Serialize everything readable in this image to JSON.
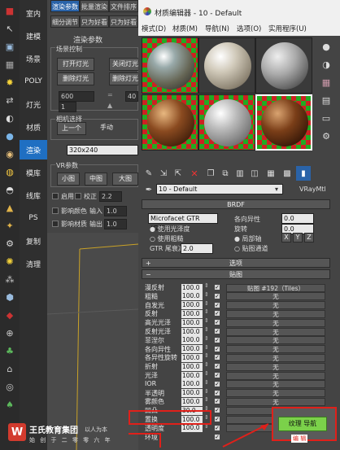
{
  "left_categories": [
    "室内",
    "建模",
    "场景",
    "POLY",
    "灯光",
    "材质",
    "渲染",
    "模库",
    "线库",
    "PS",
    "复制",
    "清理"
  ],
  "left_categories_active": 6,
  "render_panel": {
    "tabs": [
      "渲染参数",
      "批量渲染",
      "文件排序",
      "细分调节",
      "只为好看",
      "只为好看"
    ],
    "section_title": "渲染参数",
    "scene_control_label": "场景控制",
    "buttons_row1": [
      "打开灯光",
      "关闭灯光"
    ],
    "buttons_row2": [
      "删除灯光",
      "删除灯光"
    ],
    "spinner_600": "600",
    "spinner_40": "40",
    "spinner_1": "1",
    "camera_label": "相机选择",
    "camera_buttons": [
      "上一个",
      "手动"
    ],
    "resolution_value": "320x240",
    "vr_params_label": "VR参数",
    "size_buttons": [
      "小图",
      "中图",
      "大图"
    ],
    "enable_label": "启用",
    "correction_label": "校正",
    "correction_value": "2.2",
    "affect_color_label": "影响颜色",
    "input_label": "输入",
    "input_value": "1.0",
    "affect_material_label": "影响材质",
    "output_label": "输出",
    "output_value": "1.0"
  },
  "brand": {
    "name": "王氏教育集团",
    "slogan": "以人为本",
    "tagline": "始 创 于 二 零 零 六 年"
  },
  "material_editor": {
    "title": "材质编辑器 - 10 - Default",
    "menu": [
      "模式(D)",
      "材质(M)",
      "导航(N)",
      "选项(O)",
      "实用程序(U)"
    ],
    "material_name": "10 - Default",
    "material_type": "VRayMtl",
    "brdf_rollout": "BRDF",
    "brdf_type": "Microfacet GTR (GGX)",
    "anisotropy_label": "各向异性",
    "anisotropy_value": "0.0",
    "rotation_label": "旋转",
    "rotation_value": "0.0",
    "use_glossiness_label": "使用光泽度",
    "use_roughness_label": "使用粗糙",
    "local_axis_label": "局部轴",
    "axes": [
      "X",
      "Y",
      "Z"
    ],
    "map_channel_label": "贴图通道",
    "gtr_tail_label": "GTR 尾衰减",
    "gtr_tail_value": "2.0",
    "options_rollout": "选项",
    "maps_rollout": "贴图",
    "maps": [
      {
        "label": "漫反射",
        "value": "100.0",
        "checked": true,
        "map": "贴图 #192（Tiles）"
      },
      {
        "label": "粗糙",
        "value": "100.0",
        "checked": true,
        "map": "无"
      },
      {
        "label": "自发光",
        "value": "100.0",
        "checked": true,
        "map": "无"
      },
      {
        "label": "反射",
        "value": "100.0",
        "checked": true,
        "map": "无"
      },
      {
        "label": "高光光泽",
        "value": "100.0",
        "checked": true,
        "map": "无"
      },
      {
        "label": "反射光泽",
        "value": "100.0",
        "checked": true,
        "map": "无"
      },
      {
        "label": "菲涅尔",
        "value": "100.0",
        "checked": true,
        "map": "无"
      },
      {
        "label": "各向异性",
        "value": "100.0",
        "checked": true,
        "map": "无"
      },
      {
        "label": "各异性旋转",
        "value": "100.0",
        "checked": true,
        "map": "无"
      },
      {
        "label": "折射",
        "value": "100.0",
        "checked": true,
        "map": "无"
      },
      {
        "label": "光泽",
        "value": "100.0",
        "checked": true,
        "map": "无"
      },
      {
        "label": "IOR",
        "value": "100.0",
        "checked": true,
        "map": "无"
      },
      {
        "label": "半透明",
        "value": "100.0",
        "checked": true,
        "map": "无"
      },
      {
        "label": "雾颜色",
        "value": "100.0",
        "checked": true,
        "map": "无"
      },
      {
        "label": "凹凸",
        "value": "30.0",
        "checked": true,
        "map": "无"
      },
      {
        "label": "置换",
        "value": "100.0",
        "checked": true,
        "map": "无"
      },
      {
        "label": "透明度",
        "value": "100.0",
        "checked": true,
        "map": "无"
      },
      {
        "label": "环境",
        "value": "",
        "checked": true,
        "map": ""
      }
    ],
    "popup_text": "纹理 导航",
    "popup_sub": "编 辑"
  },
  "colors": {
    "accent": "#1f6fc2",
    "highlight_box": "#e0201a",
    "popup_green": "#7bd14a"
  }
}
